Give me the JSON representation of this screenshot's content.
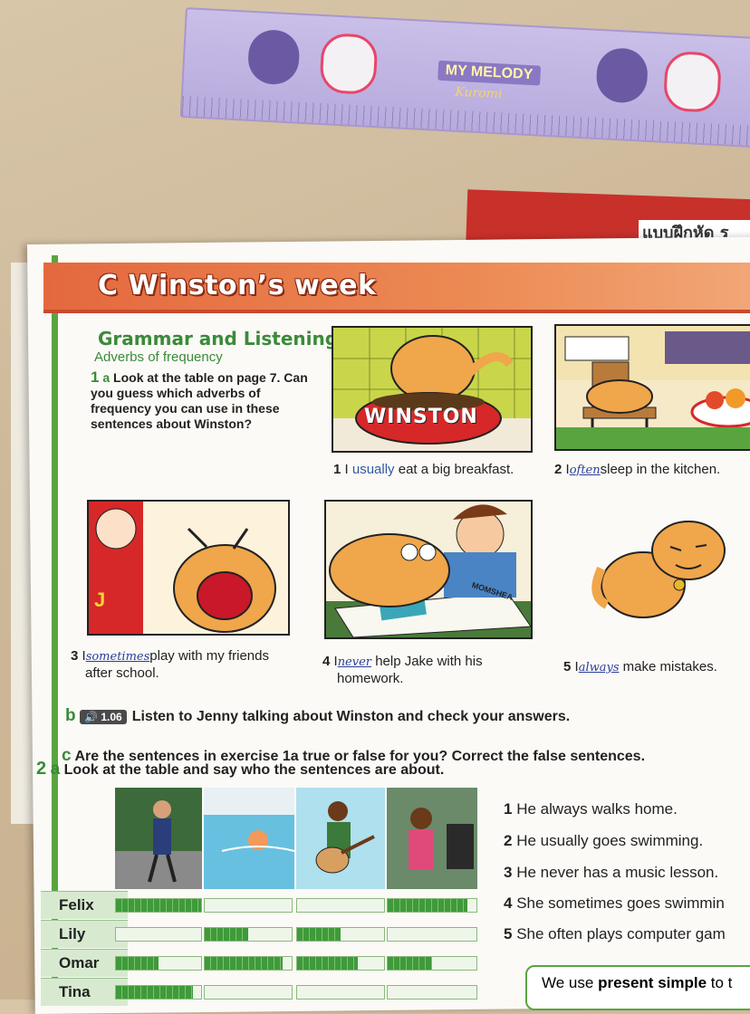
{
  "ruler": {
    "brand": "MY MELODY",
    "brand2": "Kuromi"
  },
  "thai_book": {
    "title": "แบบฝึกหัด ร"
  },
  "section": {
    "title": "C  Winston’s week",
    "heading": "Grammar and Listening",
    "subheading": "Adverbs of frequency"
  },
  "exercise1a": {
    "number": "1",
    "letter": "a",
    "text": "Look at the table on page 7. Can you guess which adverbs of frequency you can use in these sentences about Winston?"
  },
  "bowl_label": "WINSTON",
  "comic_label": "MOMSHEA",
  "captions": [
    {
      "num": "1",
      "pre": "I",
      "adverb": "usually",
      "post": "eat a big breakfast.",
      "type": "printed"
    },
    {
      "num": "2",
      "pre": "I",
      "adverb": "often",
      "post": "sleep in the kitchen.",
      "type": "handwritten"
    },
    {
      "num": "3",
      "pre": "I",
      "adverb": "sometimes",
      "post": "play with my friends",
      "line2": "after school.",
      "type": "handwritten"
    },
    {
      "num": "4",
      "pre": "I",
      "adverb": "never",
      "post": "help Jake with his",
      "line2": "homework.",
      "type": "handwritten"
    },
    {
      "num": "5",
      "pre": "I",
      "adverb": "always",
      "post": "make mistakes.",
      "type": "handwritten"
    }
  ],
  "exercise1b": {
    "letter": "b",
    "audio": "1.06",
    "text": "Listen to Jenny talking about Winston and check your answers."
  },
  "exercise1c": {
    "letter": "c",
    "text": "Are the sentences in exercise 1a true or false for you? Correct the false sentences."
  },
  "exercise2a": {
    "number": "2",
    "letter": "a",
    "text": "Look at the table and say who the sentences are about."
  },
  "table": {
    "columns": [
      "walking",
      "swimming",
      "guitar",
      "computer games"
    ],
    "rows": [
      {
        "name": "Felix",
        "levels": [
          1.0,
          0.0,
          0.0,
          0.9
        ]
      },
      {
        "name": "Lily",
        "levels": [
          0.0,
          0.5,
          0.5,
          0.0
        ]
      },
      {
        "name": "Omar",
        "levels": [
          0.5,
          0.9,
          0.7,
          0.5
        ]
      },
      {
        "name": "Tina",
        "levels": [
          0.9,
          0.0,
          0.0,
          0.0
        ]
      }
    ]
  },
  "sentences": [
    {
      "num": "1",
      "text": "He always walks home."
    },
    {
      "num": "2",
      "text": "He usually goes swimming."
    },
    {
      "num": "3",
      "text": "He never has a music lesson."
    },
    {
      "num": "4",
      "text": "She sometimes goes swimmin"
    },
    {
      "num": "5",
      "text": "She often plays computer gam"
    }
  ],
  "note": {
    "pre": "We use ",
    "bold": "present simple",
    "post": " to t"
  },
  "colors": {
    "accent_green": "#3b8a3a",
    "header_orange": "#e4683e",
    "handwriting_blue": "#2a3e9a"
  }
}
